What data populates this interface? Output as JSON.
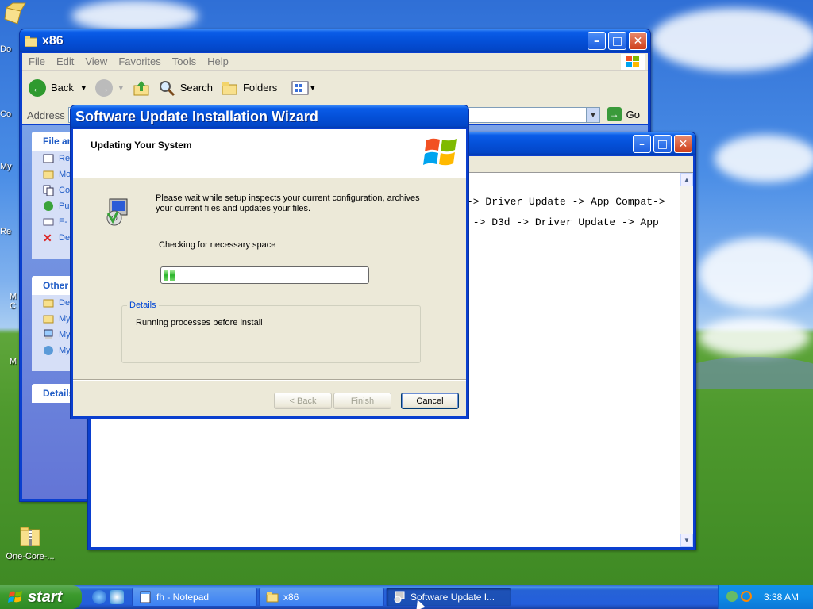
{
  "desktop": {
    "icons": [
      {
        "label": "One-Core-...",
        "icon": "zip-folder-icon"
      }
    ],
    "edge_labels": [
      "Do",
      "Co",
      "My",
      "Re",
      "M\nC",
      "M"
    ]
  },
  "explorer": {
    "title": "x86",
    "menu": [
      "File",
      "Edit",
      "View",
      "Favorites",
      "Tools",
      "Help"
    ],
    "toolbar": {
      "back": "Back",
      "search": "Search",
      "folders": "Folders"
    },
    "address_label": "Address",
    "go_label": "Go",
    "panels": [
      {
        "title": "File an",
        "items": [
          "Re",
          "Mo",
          "Co",
          "Pu",
          "E-",
          "De"
        ]
      },
      {
        "title": "Other",
        "items": [
          "De",
          "My",
          "My",
          "My"
        ]
      },
      {
        "title": "Details",
        "items": []
      }
    ]
  },
  "notepad": {
    "title": "fh - Notepad",
    "lines": [
      "-> Driver Update -> App Compat->",
      " -> D3d -> Driver Update -> App"
    ]
  },
  "wizard": {
    "title": "Software Update Installation Wizard",
    "heading": "Updating Your System",
    "description": "Please wait while setup inspects your current configuration, archives your current files and updates your files.",
    "status": "Checking for necessary space",
    "progress_fraction": 0.06,
    "details_legend": "Details",
    "details_text": "Running processes before install",
    "buttons": {
      "back": "< Back",
      "finish": "Finish",
      "cancel": "Cancel"
    }
  },
  "taskbar": {
    "start_label": "start",
    "tasks": [
      {
        "label": "fh - Notepad",
        "active": false
      },
      {
        "label": "x86",
        "active": false
      },
      {
        "label": "Software Update I...",
        "active": true
      }
    ],
    "clock": "3:38 AM"
  }
}
